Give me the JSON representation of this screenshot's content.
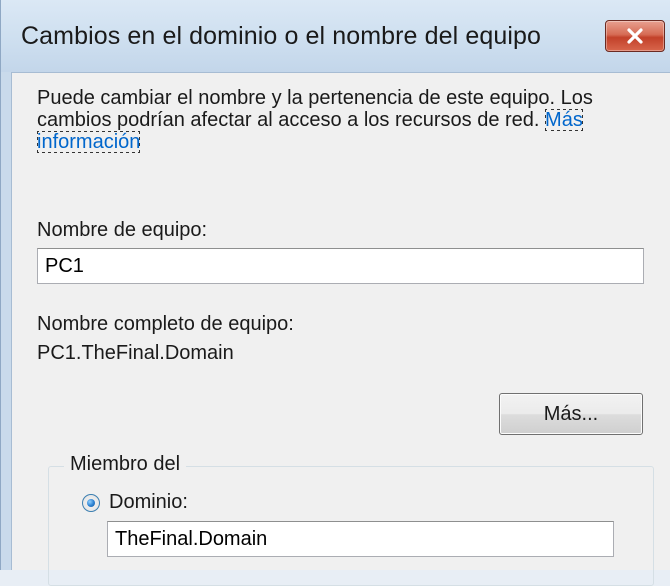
{
  "window": {
    "title": "Cambios en el dominio o el nombre del equipo"
  },
  "description": {
    "text": "Puede cambiar el nombre y la pertenencia de este equipo. Los cambios podrían afectar al acceso a los recursos de red.",
    "link": "Más información"
  },
  "computer_name": {
    "label": "Nombre de equipo:",
    "value": "PC1"
  },
  "full_computer_name": {
    "label": "Nombre completo de equipo:",
    "value": "PC1.TheFinal.Domain"
  },
  "more_button": {
    "label": "Más..."
  },
  "member_of": {
    "legend": "Miembro del",
    "domain_option": {
      "label": "Dominio:",
      "selected": true,
      "value": "TheFinal.Domain"
    }
  },
  "colors": {
    "title_bar": "#cfe0f0",
    "client_bg": "#f0f0f0",
    "link": "#0066cc",
    "close_button": "#c2412a"
  },
  "icons": {
    "close": "close-icon",
    "radio": "radio-selected-icon"
  }
}
